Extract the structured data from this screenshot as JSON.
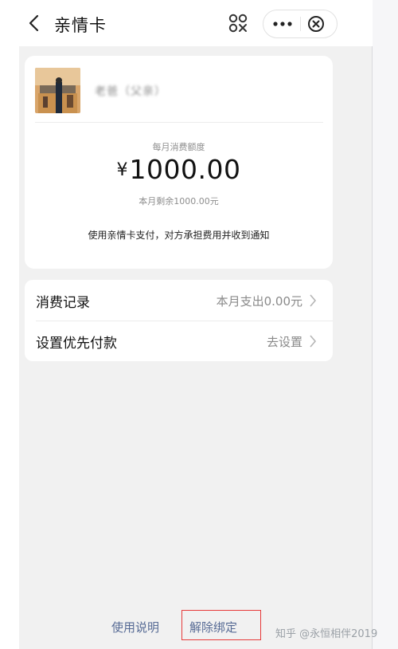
{
  "header": {
    "title": "亲情卡",
    "back_icon": "chevron-left-icon",
    "scan_icon": "scan-code-icon",
    "more_icon": "more-dots-icon",
    "close_icon": "close-circle-icon"
  },
  "card": {
    "user_name": "老爸（父亲）",
    "limit_label": "每月消费额度",
    "currency": "¥",
    "amount": "1000.00",
    "remaining": "本月剩余1000.00元",
    "notice": "使用亲情卡支付，对方承担费用并收到通知"
  },
  "menu": {
    "items": [
      {
        "label": "消费记录",
        "value": "本月支出0.00元"
      },
      {
        "label": "设置优先付款",
        "value": "去设置"
      }
    ]
  },
  "footer": {
    "usage_link": "使用说明",
    "unbind_link": "解除绑定"
  },
  "watermark": "知乎 @永恒相伴2019",
  "colors": {
    "link": "#576b95",
    "highlight_box": "#e63a3a",
    "background": "#f1f1f1"
  }
}
